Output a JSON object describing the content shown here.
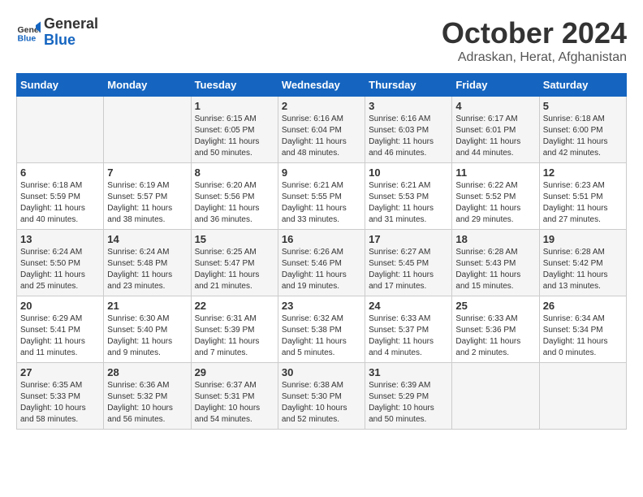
{
  "logo": {
    "line1": "General",
    "line2": "Blue"
  },
  "title": "October 2024",
  "location": "Adraskan, Herat, Afghanistan",
  "days_of_week": [
    "Sunday",
    "Monday",
    "Tuesday",
    "Wednesday",
    "Thursday",
    "Friday",
    "Saturday"
  ],
  "weeks": [
    [
      {
        "day": "",
        "info": ""
      },
      {
        "day": "",
        "info": ""
      },
      {
        "day": "1",
        "info": "Sunrise: 6:15 AM\nSunset: 6:05 PM\nDaylight: 11 hours and 50 minutes."
      },
      {
        "day": "2",
        "info": "Sunrise: 6:16 AM\nSunset: 6:04 PM\nDaylight: 11 hours and 48 minutes."
      },
      {
        "day": "3",
        "info": "Sunrise: 6:16 AM\nSunset: 6:03 PM\nDaylight: 11 hours and 46 minutes."
      },
      {
        "day": "4",
        "info": "Sunrise: 6:17 AM\nSunset: 6:01 PM\nDaylight: 11 hours and 44 minutes."
      },
      {
        "day": "5",
        "info": "Sunrise: 6:18 AM\nSunset: 6:00 PM\nDaylight: 11 hours and 42 minutes."
      }
    ],
    [
      {
        "day": "6",
        "info": "Sunrise: 6:18 AM\nSunset: 5:59 PM\nDaylight: 11 hours and 40 minutes."
      },
      {
        "day": "7",
        "info": "Sunrise: 6:19 AM\nSunset: 5:57 PM\nDaylight: 11 hours and 38 minutes."
      },
      {
        "day": "8",
        "info": "Sunrise: 6:20 AM\nSunset: 5:56 PM\nDaylight: 11 hours and 36 minutes."
      },
      {
        "day": "9",
        "info": "Sunrise: 6:21 AM\nSunset: 5:55 PM\nDaylight: 11 hours and 33 minutes."
      },
      {
        "day": "10",
        "info": "Sunrise: 6:21 AM\nSunset: 5:53 PM\nDaylight: 11 hours and 31 minutes."
      },
      {
        "day": "11",
        "info": "Sunrise: 6:22 AM\nSunset: 5:52 PM\nDaylight: 11 hours and 29 minutes."
      },
      {
        "day": "12",
        "info": "Sunrise: 6:23 AM\nSunset: 5:51 PM\nDaylight: 11 hours and 27 minutes."
      }
    ],
    [
      {
        "day": "13",
        "info": "Sunrise: 6:24 AM\nSunset: 5:50 PM\nDaylight: 11 hours and 25 minutes."
      },
      {
        "day": "14",
        "info": "Sunrise: 6:24 AM\nSunset: 5:48 PM\nDaylight: 11 hours and 23 minutes."
      },
      {
        "day": "15",
        "info": "Sunrise: 6:25 AM\nSunset: 5:47 PM\nDaylight: 11 hours and 21 minutes."
      },
      {
        "day": "16",
        "info": "Sunrise: 6:26 AM\nSunset: 5:46 PM\nDaylight: 11 hours and 19 minutes."
      },
      {
        "day": "17",
        "info": "Sunrise: 6:27 AM\nSunset: 5:45 PM\nDaylight: 11 hours and 17 minutes."
      },
      {
        "day": "18",
        "info": "Sunrise: 6:28 AM\nSunset: 5:43 PM\nDaylight: 11 hours and 15 minutes."
      },
      {
        "day": "19",
        "info": "Sunrise: 6:28 AM\nSunset: 5:42 PM\nDaylight: 11 hours and 13 minutes."
      }
    ],
    [
      {
        "day": "20",
        "info": "Sunrise: 6:29 AM\nSunset: 5:41 PM\nDaylight: 11 hours and 11 minutes."
      },
      {
        "day": "21",
        "info": "Sunrise: 6:30 AM\nSunset: 5:40 PM\nDaylight: 11 hours and 9 minutes."
      },
      {
        "day": "22",
        "info": "Sunrise: 6:31 AM\nSunset: 5:39 PM\nDaylight: 11 hours and 7 minutes."
      },
      {
        "day": "23",
        "info": "Sunrise: 6:32 AM\nSunset: 5:38 PM\nDaylight: 11 hours and 5 minutes."
      },
      {
        "day": "24",
        "info": "Sunrise: 6:33 AM\nSunset: 5:37 PM\nDaylight: 11 hours and 4 minutes."
      },
      {
        "day": "25",
        "info": "Sunrise: 6:33 AM\nSunset: 5:36 PM\nDaylight: 11 hours and 2 minutes."
      },
      {
        "day": "26",
        "info": "Sunrise: 6:34 AM\nSunset: 5:34 PM\nDaylight: 11 hours and 0 minutes."
      }
    ],
    [
      {
        "day": "27",
        "info": "Sunrise: 6:35 AM\nSunset: 5:33 PM\nDaylight: 10 hours and 58 minutes."
      },
      {
        "day": "28",
        "info": "Sunrise: 6:36 AM\nSunset: 5:32 PM\nDaylight: 10 hours and 56 minutes."
      },
      {
        "day": "29",
        "info": "Sunrise: 6:37 AM\nSunset: 5:31 PM\nDaylight: 10 hours and 54 minutes."
      },
      {
        "day": "30",
        "info": "Sunrise: 6:38 AM\nSunset: 5:30 PM\nDaylight: 10 hours and 52 minutes."
      },
      {
        "day": "31",
        "info": "Sunrise: 6:39 AM\nSunset: 5:29 PM\nDaylight: 10 hours and 50 minutes."
      },
      {
        "day": "",
        "info": ""
      },
      {
        "day": "",
        "info": ""
      }
    ]
  ]
}
